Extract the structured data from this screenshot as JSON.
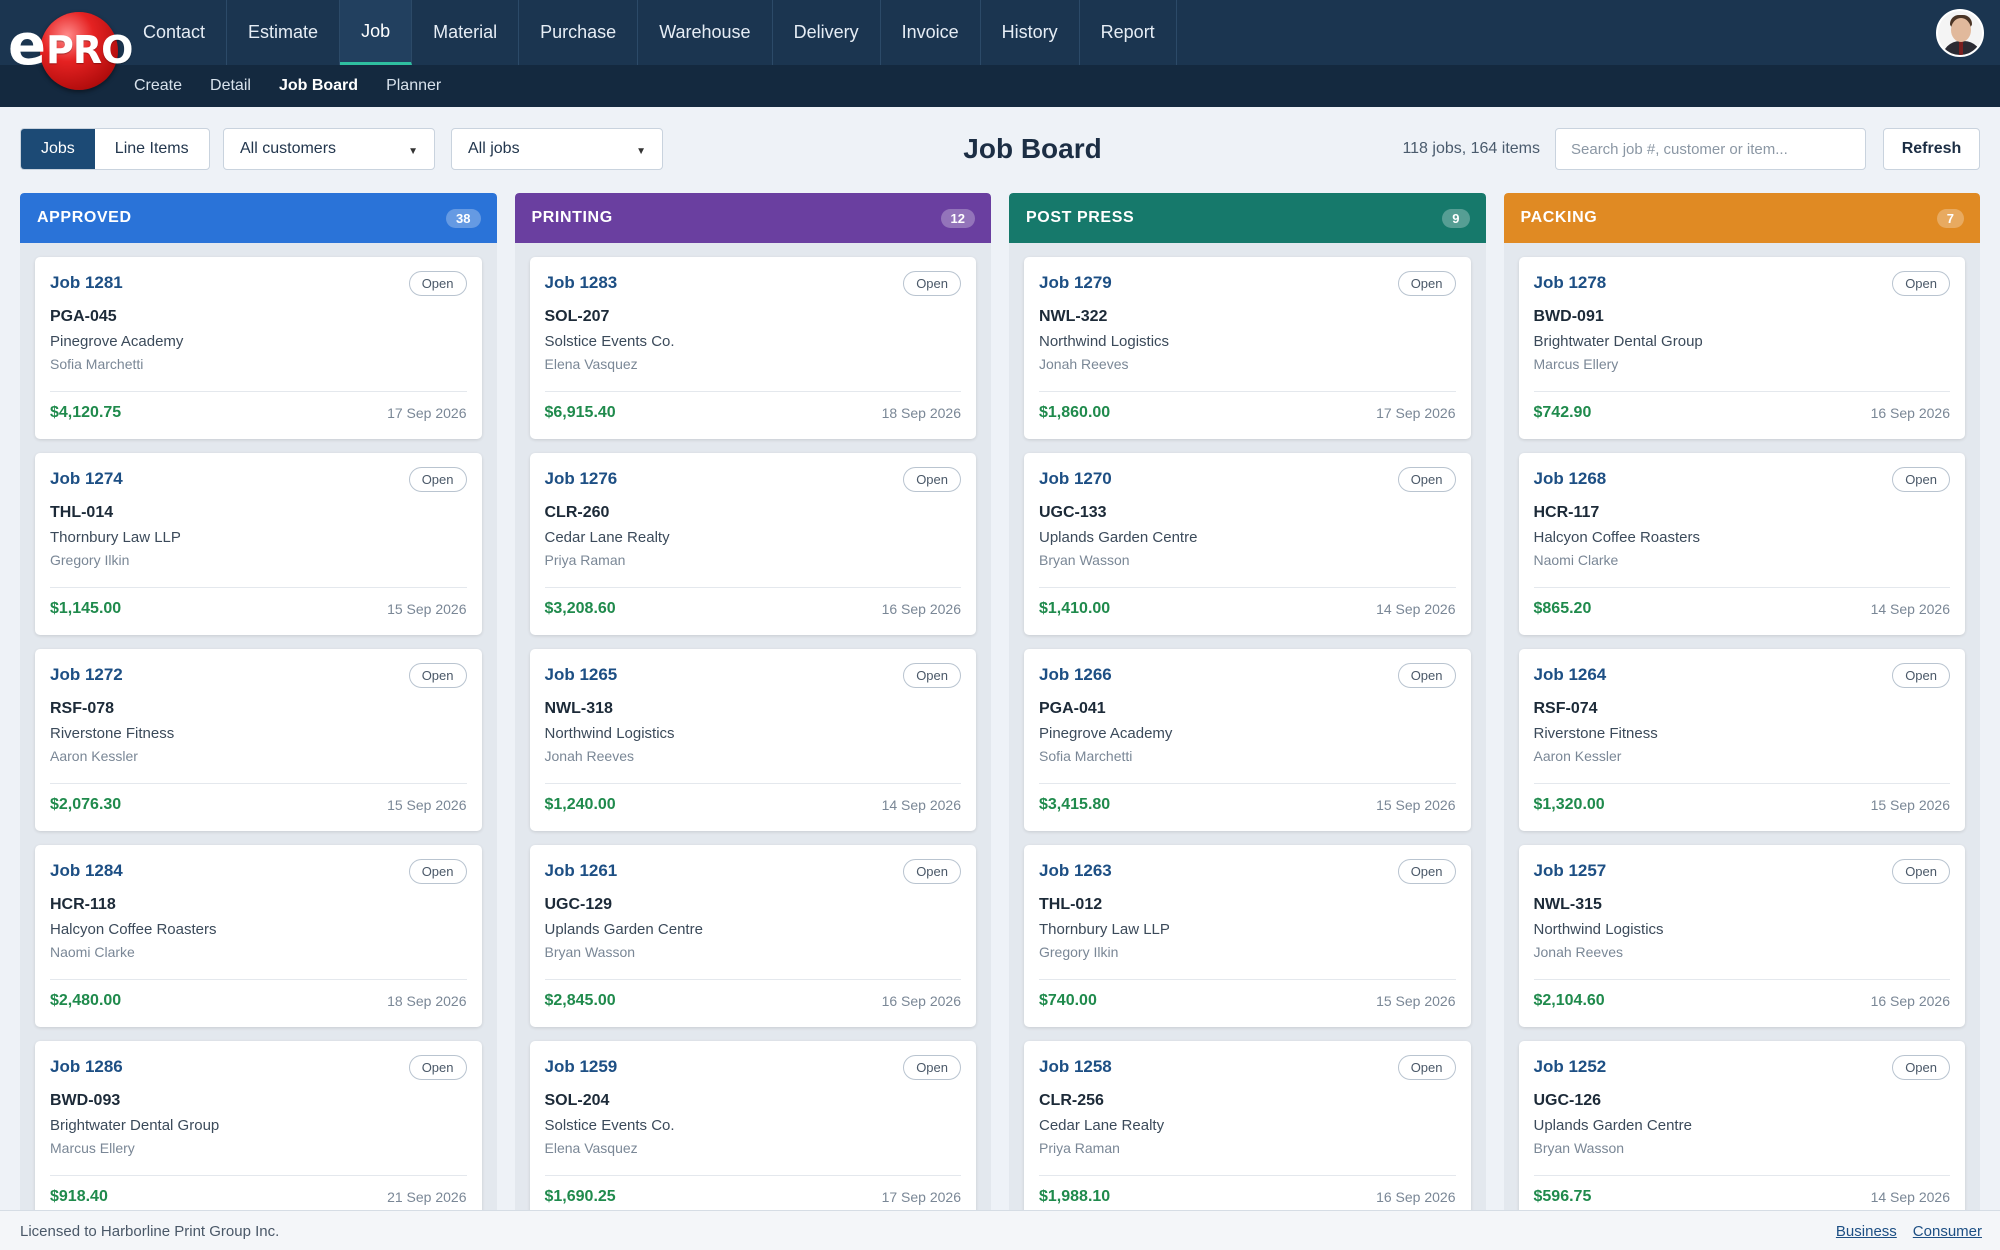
{
  "brand": {
    "prefix": "e",
    "name": "PRO"
  },
  "mainnav": [
    "Contact",
    "Estimate",
    "Job",
    "Material",
    "Purchase",
    "Warehouse",
    "Delivery",
    "Invoice",
    "History",
    "Report"
  ],
  "mainnav_active": "Job",
  "subnav": [
    "Create",
    "Detail",
    "Job Board",
    "Planner"
  ],
  "subnav_active": "Job Board",
  "toolbar": {
    "view_jobs": "Jobs",
    "view_line_items": "Line Items",
    "customer_filter": "All customers",
    "job_filter": "All jobs",
    "title": "Job Board",
    "count": "118 jobs, 164 items",
    "search_placeholder": "Search job #, customer or item...",
    "refresh": "Refresh"
  },
  "columns": [
    {
      "title": "APPROVED",
      "count": "38",
      "color": "#2a73d8",
      "cards": [
        {
          "job": "Job 1281",
          "status": "Open",
          "code": "PGA-045",
          "customer": "Pinegrove Academy",
          "contact": "Sofia Marchetti",
          "amount": "$4,120.75",
          "date": "17 Sep 2026"
        },
        {
          "job": "Job 1274",
          "status": "Open",
          "code": "THL-014",
          "customer": "Thornbury Law LLP",
          "contact": "Gregory Ilkin",
          "amount": "$1,145.00",
          "date": "15 Sep 2026"
        },
        {
          "job": "Job 1272",
          "status": "Open",
          "code": "RSF-078",
          "customer": "Riverstone Fitness",
          "contact": "Aaron Kessler",
          "amount": "$2,076.30",
          "date": "15 Sep 2026"
        },
        {
          "job": "Job 1284",
          "status": "Open",
          "code": "HCR-118",
          "customer": "Halcyon Coffee Roasters",
          "contact": "Naomi Clarke",
          "amount": "$2,480.00",
          "date": "18 Sep 2026"
        },
        {
          "job": "Job 1286",
          "status": "Open",
          "code": "BWD-093",
          "customer": "Brightwater Dental Group",
          "contact": "Marcus Ellery",
          "amount": "$918.40",
          "date": "21 Sep 2026"
        }
      ]
    },
    {
      "title": "PRINTING",
      "count": "12",
      "color": "#6a3fa0",
      "cards": [
        {
          "job": "Job 1283",
          "status": "Open",
          "code": "SOL-207",
          "customer": "Solstice Events Co.",
          "contact": "Elena Vasquez",
          "amount": "$6,915.40",
          "date": "18 Sep 2026"
        },
        {
          "job": "Job 1276",
          "status": "Open",
          "code": "CLR-260",
          "customer": "Cedar Lane Realty",
          "contact": "Priya Raman",
          "amount": "$3,208.60",
          "date": "16 Sep 2026"
        },
        {
          "job": "Job 1265",
          "status": "Open",
          "code": "NWL-318",
          "customer": "Northwind Logistics",
          "contact": "Jonah Reeves",
          "amount": "$1,240.00",
          "date": "14 Sep 2026"
        },
        {
          "job": "Job 1261",
          "status": "Open",
          "code": "UGC-129",
          "customer": "Uplands Garden Centre",
          "contact": "Bryan Wasson",
          "amount": "$2,845.00",
          "date": "16 Sep 2026"
        },
        {
          "job": "Job 1259",
          "status": "Open",
          "code": "SOL-204",
          "customer": "Solstice Events Co.",
          "contact": "Elena Vasquez",
          "amount": "$1,690.25",
          "date": "17 Sep 2026"
        }
      ]
    },
    {
      "title": "POST PRESS",
      "count": "9",
      "color": "#16796b",
      "cards": [
        {
          "job": "Job 1279",
          "status": "Open",
          "code": "NWL-322",
          "customer": "Northwind Logistics",
          "contact": "Jonah Reeves",
          "amount": "$1,860.00",
          "date": "17 Sep 2026"
        },
        {
          "job": "Job 1270",
          "status": "Open",
          "code": "UGC-133",
          "customer": "Uplands Garden Centre",
          "contact": "Bryan Wasson",
          "amount": "$1,410.00",
          "date": "14 Sep 2026"
        },
        {
          "job": "Job 1266",
          "status": "Open",
          "code": "PGA-041",
          "customer": "Pinegrove Academy",
          "contact": "Sofia Marchetti",
          "amount": "$3,415.80",
          "date": "15 Sep 2026"
        },
        {
          "job": "Job 1263",
          "status": "Open",
          "code": "THL-012",
          "customer": "Thornbury Law LLP",
          "contact": "Gregory Ilkin",
          "amount": "$740.00",
          "date": "15 Sep 2026"
        },
        {
          "job": "Job 1258",
          "status": "Open",
          "code": "CLR-256",
          "customer": "Cedar Lane Realty",
          "contact": "Priya Raman",
          "amount": "$1,988.10",
          "date": "16 Sep 2026"
        }
      ]
    },
    {
      "title": "PACKING",
      "count": "7",
      "color": "#e08a23",
      "cards": [
        {
          "job": "Job 1278",
          "status": "Open",
          "code": "BWD-091",
          "customer": "Brightwater Dental Group",
          "contact": "Marcus Ellery",
          "amount": "$742.90",
          "date": "16 Sep 2026"
        },
        {
          "job": "Job 1268",
          "status": "Open",
          "code": "HCR-117",
          "customer": "Halcyon Coffee Roasters",
          "contact": "Naomi Clarke",
          "amount": "$865.20",
          "date": "14 Sep 2026"
        },
        {
          "job": "Job 1264",
          "status": "Open",
          "code": "RSF-074",
          "customer": "Riverstone Fitness",
          "contact": "Aaron Kessler",
          "amount": "$1,320.00",
          "date": "15 Sep 2026"
        },
        {
          "job": "Job 1257",
          "status": "Open",
          "code": "NWL-315",
          "customer": "Northwind Logistics",
          "contact": "Jonah Reeves",
          "amount": "$2,104.60",
          "date": "16 Sep 2026"
        },
        {
          "job": "Job 1252",
          "status": "Open",
          "code": "UGC-126",
          "customer": "Uplands Garden Centre",
          "contact": "Bryan Wasson",
          "amount": "$596.75",
          "date": "14 Sep 2026"
        }
      ]
    }
  ],
  "footer": {
    "license": "Licensed to Harborline Print Group Inc.",
    "link_business": "Business",
    "link_consumer": "Consumer"
  },
  "icons": {
    "avatar": "user-avatar-icon",
    "caret": "caret-down-icon"
  }
}
